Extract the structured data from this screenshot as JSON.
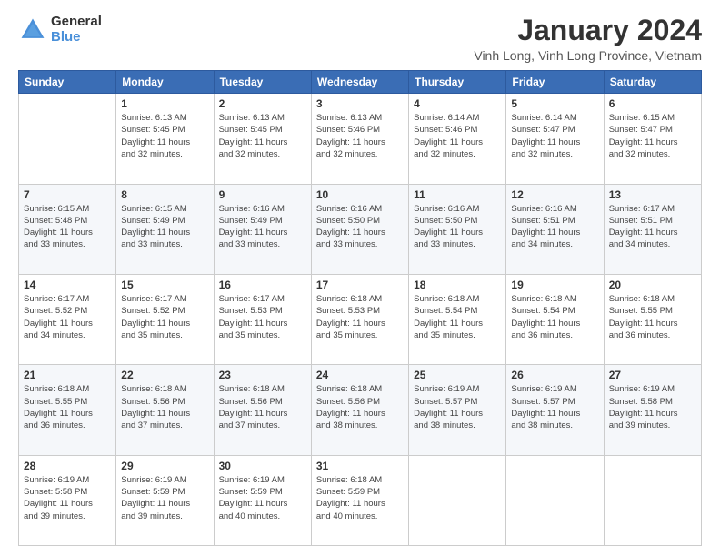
{
  "logo": {
    "general": "General",
    "blue": "Blue"
  },
  "title": "January 2024",
  "location": "Vinh Long, Vinh Long Province, Vietnam",
  "days_header": [
    "Sunday",
    "Monday",
    "Tuesday",
    "Wednesday",
    "Thursday",
    "Friday",
    "Saturday"
  ],
  "weeks": [
    [
      {
        "day": "",
        "info": ""
      },
      {
        "day": "1",
        "info": "Sunrise: 6:13 AM\nSunset: 5:45 PM\nDaylight: 11 hours\nand 32 minutes."
      },
      {
        "day": "2",
        "info": "Sunrise: 6:13 AM\nSunset: 5:45 PM\nDaylight: 11 hours\nand 32 minutes."
      },
      {
        "day": "3",
        "info": "Sunrise: 6:13 AM\nSunset: 5:46 PM\nDaylight: 11 hours\nand 32 minutes."
      },
      {
        "day": "4",
        "info": "Sunrise: 6:14 AM\nSunset: 5:46 PM\nDaylight: 11 hours\nand 32 minutes."
      },
      {
        "day": "5",
        "info": "Sunrise: 6:14 AM\nSunset: 5:47 PM\nDaylight: 11 hours\nand 32 minutes."
      },
      {
        "day": "6",
        "info": "Sunrise: 6:15 AM\nSunset: 5:47 PM\nDaylight: 11 hours\nand 32 minutes."
      }
    ],
    [
      {
        "day": "7",
        "info": "Sunrise: 6:15 AM\nSunset: 5:48 PM\nDaylight: 11 hours\nand 33 minutes."
      },
      {
        "day": "8",
        "info": "Sunrise: 6:15 AM\nSunset: 5:49 PM\nDaylight: 11 hours\nand 33 minutes."
      },
      {
        "day": "9",
        "info": "Sunrise: 6:16 AM\nSunset: 5:49 PM\nDaylight: 11 hours\nand 33 minutes."
      },
      {
        "day": "10",
        "info": "Sunrise: 6:16 AM\nSunset: 5:50 PM\nDaylight: 11 hours\nand 33 minutes."
      },
      {
        "day": "11",
        "info": "Sunrise: 6:16 AM\nSunset: 5:50 PM\nDaylight: 11 hours\nand 33 minutes."
      },
      {
        "day": "12",
        "info": "Sunrise: 6:16 AM\nSunset: 5:51 PM\nDaylight: 11 hours\nand 34 minutes."
      },
      {
        "day": "13",
        "info": "Sunrise: 6:17 AM\nSunset: 5:51 PM\nDaylight: 11 hours\nand 34 minutes."
      }
    ],
    [
      {
        "day": "14",
        "info": "Sunrise: 6:17 AM\nSunset: 5:52 PM\nDaylight: 11 hours\nand 34 minutes."
      },
      {
        "day": "15",
        "info": "Sunrise: 6:17 AM\nSunset: 5:52 PM\nDaylight: 11 hours\nand 35 minutes."
      },
      {
        "day": "16",
        "info": "Sunrise: 6:17 AM\nSunset: 5:53 PM\nDaylight: 11 hours\nand 35 minutes."
      },
      {
        "day": "17",
        "info": "Sunrise: 6:18 AM\nSunset: 5:53 PM\nDaylight: 11 hours\nand 35 minutes."
      },
      {
        "day": "18",
        "info": "Sunrise: 6:18 AM\nSunset: 5:54 PM\nDaylight: 11 hours\nand 35 minutes."
      },
      {
        "day": "19",
        "info": "Sunrise: 6:18 AM\nSunset: 5:54 PM\nDaylight: 11 hours\nand 36 minutes."
      },
      {
        "day": "20",
        "info": "Sunrise: 6:18 AM\nSunset: 5:55 PM\nDaylight: 11 hours\nand 36 minutes."
      }
    ],
    [
      {
        "day": "21",
        "info": "Sunrise: 6:18 AM\nSunset: 5:55 PM\nDaylight: 11 hours\nand 36 minutes."
      },
      {
        "day": "22",
        "info": "Sunrise: 6:18 AM\nSunset: 5:56 PM\nDaylight: 11 hours\nand 37 minutes."
      },
      {
        "day": "23",
        "info": "Sunrise: 6:18 AM\nSunset: 5:56 PM\nDaylight: 11 hours\nand 37 minutes."
      },
      {
        "day": "24",
        "info": "Sunrise: 6:18 AM\nSunset: 5:56 PM\nDaylight: 11 hours\nand 38 minutes."
      },
      {
        "day": "25",
        "info": "Sunrise: 6:19 AM\nSunset: 5:57 PM\nDaylight: 11 hours\nand 38 minutes."
      },
      {
        "day": "26",
        "info": "Sunrise: 6:19 AM\nSunset: 5:57 PM\nDaylight: 11 hours\nand 38 minutes."
      },
      {
        "day": "27",
        "info": "Sunrise: 6:19 AM\nSunset: 5:58 PM\nDaylight: 11 hours\nand 39 minutes."
      }
    ],
    [
      {
        "day": "28",
        "info": "Sunrise: 6:19 AM\nSunset: 5:58 PM\nDaylight: 11 hours\nand 39 minutes."
      },
      {
        "day": "29",
        "info": "Sunrise: 6:19 AM\nSunset: 5:59 PM\nDaylight: 11 hours\nand 39 minutes."
      },
      {
        "day": "30",
        "info": "Sunrise: 6:19 AM\nSunset: 5:59 PM\nDaylight: 11 hours\nand 40 minutes."
      },
      {
        "day": "31",
        "info": "Sunrise: 6:18 AM\nSunset: 5:59 PM\nDaylight: 11 hours\nand 40 minutes."
      },
      {
        "day": "",
        "info": ""
      },
      {
        "day": "",
        "info": ""
      },
      {
        "day": "",
        "info": ""
      }
    ]
  ]
}
